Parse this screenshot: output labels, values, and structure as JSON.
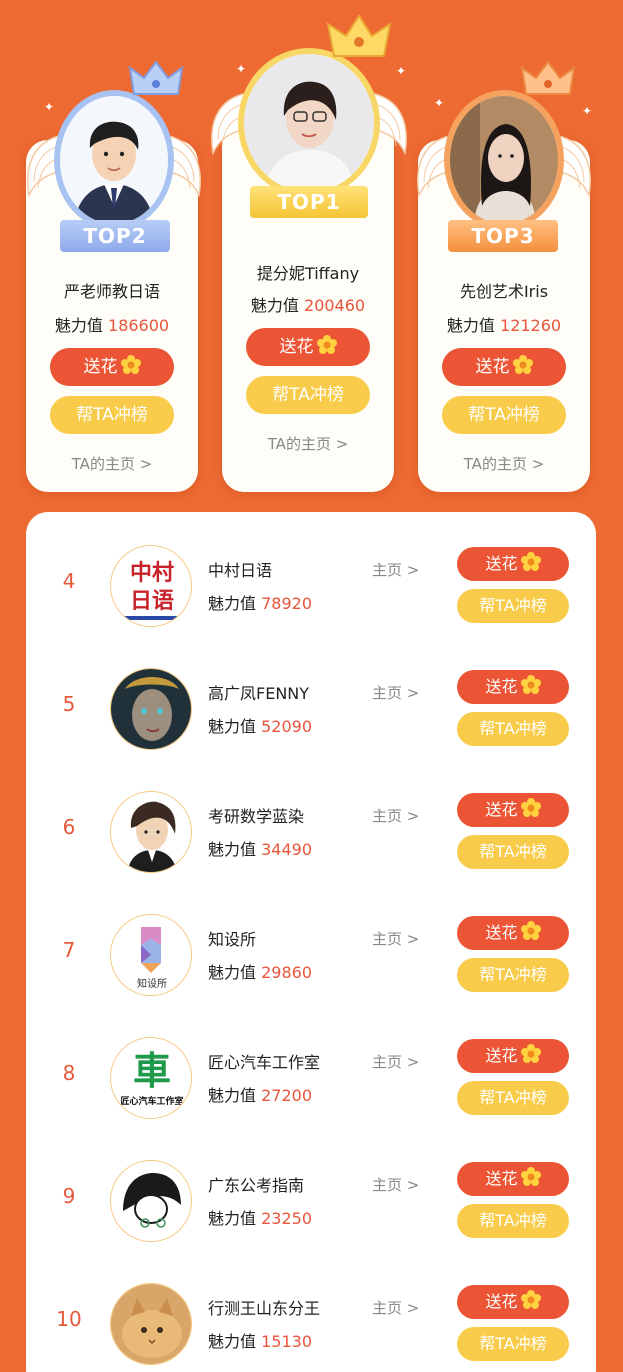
{
  "colors": {
    "background": "#ee6a33",
    "flower_button": "#eb5535",
    "rank_button": "#f8cc4a",
    "charm_value": "#e8553a"
  },
  "top3": [
    {
      "rank_label": "TOP2",
      "name": "严老师教日语",
      "charm_label": "魅力值",
      "charm_value": "186600",
      "flower_label": "送花",
      "rank_button_label": "帮TA冲榜",
      "home_link": "TA的主页 >"
    },
    {
      "rank_label": "TOP1",
      "name": "提分妮Tiffany",
      "charm_label": "魅力值",
      "charm_value": "200460",
      "flower_label": "送花",
      "rank_button_label": "帮TA冲榜",
      "home_link": "TA的主页 >"
    },
    {
      "rank_label": "TOP3",
      "name": "先创艺术Iris",
      "charm_label": "魅力值",
      "charm_value": "121260",
      "flower_label": "送花",
      "rank_button_label": "帮TA冲榜",
      "home_link": "TA的主页 >"
    }
  ],
  "list": [
    {
      "rank": "4",
      "name": "中村日语",
      "charm_label": "魅力值",
      "charm_value": "78920",
      "home": "主页 >",
      "flower_label": "送花",
      "rank_button_label": "帮TA冲榜",
      "avatar_text_top": "中村",
      "avatar_text_bottom": "日语"
    },
    {
      "rank": "5",
      "name": "高广凤FENNY",
      "charm_label": "魅力值",
      "charm_value": "52090",
      "home": "主页 >",
      "flower_label": "送花",
      "rank_button_label": "帮TA冲榜"
    },
    {
      "rank": "6",
      "name": "考研数学蓝染",
      "charm_label": "魅力值",
      "charm_value": "34490",
      "home": "主页 >",
      "flower_label": "送花",
      "rank_button_label": "帮TA冲榜"
    },
    {
      "rank": "7",
      "name": "知设所",
      "charm_label": "魅力值",
      "charm_value": "29860",
      "home": "主页 >",
      "flower_label": "送花",
      "rank_button_label": "帮TA冲榜",
      "avatar_text_bottom": "知设所"
    },
    {
      "rank": "8",
      "name": "匠心汽车工作室",
      "charm_label": "魅力值",
      "charm_value": "27200",
      "home": "主页 >",
      "flower_label": "送花",
      "rank_button_label": "帮TA冲榜",
      "avatar_text_top": "車",
      "avatar_text_bottom": "匠心汽车工作室"
    },
    {
      "rank": "9",
      "name": "广东公考指南",
      "charm_label": "魅力值",
      "charm_value": "23250",
      "home": "主页 >",
      "flower_label": "送花",
      "rank_button_label": "帮TA冲榜"
    },
    {
      "rank": "10",
      "name": "行测王山东分王",
      "charm_label": "魅力值",
      "charm_value": "15130",
      "home": "主页 >",
      "flower_label": "送花",
      "rank_button_label": "帮TA冲榜"
    }
  ]
}
